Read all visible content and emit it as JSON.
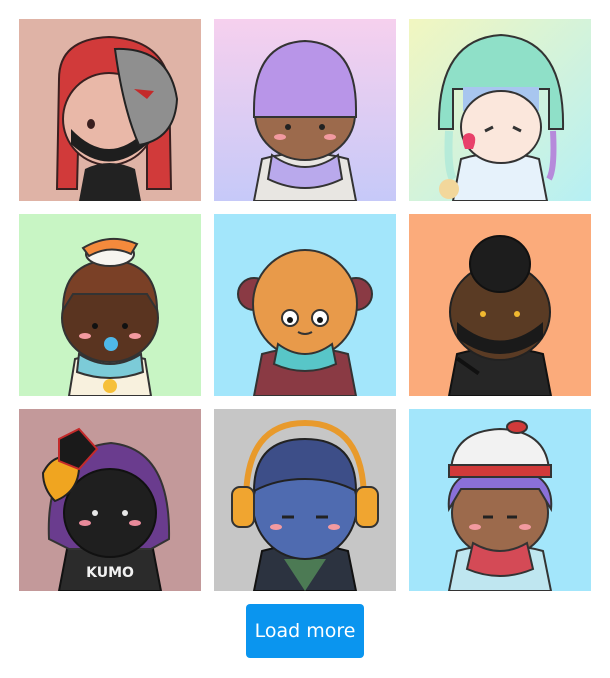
{
  "gallery": {
    "items": [
      {
        "name": "masked-red-hair",
        "bg": "#dfb3a6"
      },
      {
        "name": "purple-beanie",
        "bg": "#e6d2f6"
      },
      {
        "name": "jellyfish-hood",
        "bg": "#d6f3dc"
      },
      {
        "name": "sushi-bun",
        "bg": "#c8f5c4"
      },
      {
        "name": "monkey-hood",
        "bg": "#a3e6fb"
      },
      {
        "name": "black-mask-ninja",
        "bg": "#fbab7b"
      },
      {
        "name": "fox-mask-kumo",
        "bg": "#c3999a"
      },
      {
        "name": "headphones-blue",
        "bg": "#c6c6c6"
      },
      {
        "name": "winter-beanie",
        "bg": "#a3e6fb"
      }
    ],
    "shirt_text": "KUMO"
  },
  "actions": {
    "load_more_label": "Load more"
  },
  "colors": {
    "accent": "#0a95ef"
  }
}
